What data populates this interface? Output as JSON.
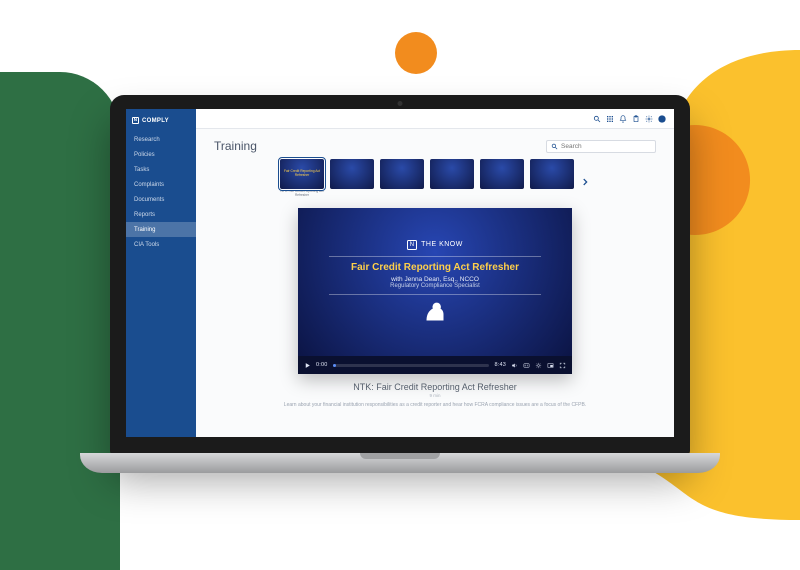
{
  "app": {
    "brand": "COMPLY"
  },
  "sidebar": {
    "items": [
      {
        "label": "Research"
      },
      {
        "label": "Policies"
      },
      {
        "label": "Tasks"
      },
      {
        "label": "Complaints"
      },
      {
        "label": "Documents"
      },
      {
        "label": "Reports"
      },
      {
        "label": "Training"
      },
      {
        "label": "CIA Tools"
      }
    ],
    "active_index": 6
  },
  "page": {
    "title": "Training",
    "search_placeholder": "Search"
  },
  "carousel": {
    "items": [
      {
        "title": "Fair Credit Reporting Act Refresher",
        "caption": "NTK: Fair Credit Reporting Act Refresher"
      },
      {
        "title": "",
        "caption": ""
      },
      {
        "title": "",
        "caption": ""
      },
      {
        "title": "",
        "caption": ""
      },
      {
        "title": "",
        "caption": ""
      },
      {
        "title": "",
        "caption": ""
      }
    ],
    "selected_index": 0
  },
  "video": {
    "brand": "THE KNOW",
    "title": "Fair Credit Reporting Act Refresher",
    "presenter": "with Jenna Dean, Esq., NCCO",
    "role": "Regulatory Compliance Specialist",
    "time_current": "0:00",
    "time_total": "8:43",
    "progress_pct": 2
  },
  "detail": {
    "title": "NTK: Fair Credit Reporting Act Refresher",
    "meta": "9 min",
    "description": "Learn about your financial institution responsibilities as a credit reporter and hear how FCRA compliance issues are a focus of the CFPB."
  }
}
